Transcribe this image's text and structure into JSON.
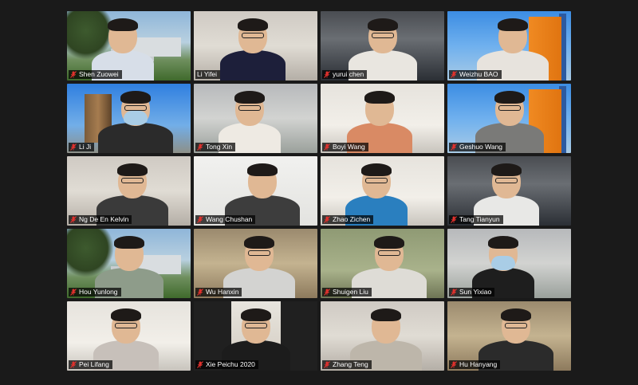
{
  "meeting": {
    "participants": [
      {
        "name": "Shen Zuowei",
        "muted": true,
        "background": "campus",
        "shirt": "#d7dee8",
        "active": false
      },
      {
        "name": "Li Yifei",
        "muted": false,
        "background": "room",
        "shirt": "#1d1f3a",
        "active": true
      },
      {
        "name": "yurui chen",
        "muted": true,
        "background": "office-dark",
        "shirt": "#e9e6e0",
        "active": false
      },
      {
        "name": "Weizhu BAO",
        "muted": true,
        "background": "sky-tower",
        "shirt": "#e7e3dd",
        "active": false
      },
      {
        "name": "Li Ji",
        "muted": true,
        "background": "city",
        "shirt": "#2b2b2b",
        "active": false
      },
      {
        "name": "Tong Xin",
        "muted": true,
        "background": "office",
        "shirt": "#eeeae3",
        "active": false
      },
      {
        "name": "Boyi Wang",
        "muted": true,
        "background": "light",
        "shirt": "#d98a64",
        "active": false
      },
      {
        "name": "Geshuo Wang",
        "muted": true,
        "background": "sky-tower",
        "shirt": "#7a7a78",
        "active": false
      },
      {
        "name": "Ng De En  Kelvin",
        "muted": true,
        "background": "room",
        "shirt": "#3a3a3a",
        "active": false
      },
      {
        "name": "Wang Chushan",
        "muted": true,
        "background": "white",
        "shirt": "#3d3d3d",
        "active": false
      },
      {
        "name": "Zhao Zichen",
        "muted": true,
        "background": "light",
        "shirt": "#2a7fbf",
        "active": false
      },
      {
        "name": "Tang Tianyun",
        "muted": true,
        "background": "office-dark",
        "shirt": "#e8e8e6",
        "active": false
      },
      {
        "name": "Hou Yunlong",
        "muted": true,
        "background": "campus",
        "shirt": "#8e9c8a",
        "active": false
      },
      {
        "name": "Wu Hanxin",
        "muted": true,
        "background": "warm",
        "shirt": "#d3d3d1",
        "active": false
      },
      {
        "name": "Shuigen Liu",
        "muted": true,
        "background": "greenwall",
        "shirt": "#dedcd6",
        "active": false
      },
      {
        "name": "Sun Yixiao",
        "muted": true,
        "background": "office",
        "shirt": "#1e1e1e",
        "active": false
      },
      {
        "name": "Pei Lifang",
        "muted": true,
        "background": "light",
        "shirt": "#c7c0ba",
        "active": false
      },
      {
        "name": "Xie Peichu 2020",
        "muted": true,
        "background": "dark",
        "shirt": "#1c1c1c",
        "active": false
      },
      {
        "name": "Zhang Teng",
        "muted": true,
        "background": "room",
        "shirt": "#bdb6aa",
        "active": false
      },
      {
        "name": "Hu Hanyang",
        "muted": true,
        "background": "warm",
        "shirt": "#2b2b2b",
        "active": false
      }
    ]
  },
  "colors": {
    "active_speaker_border": "#d8e05a",
    "muted_icon": "#e0312d",
    "label_text": "#ffffff"
  }
}
